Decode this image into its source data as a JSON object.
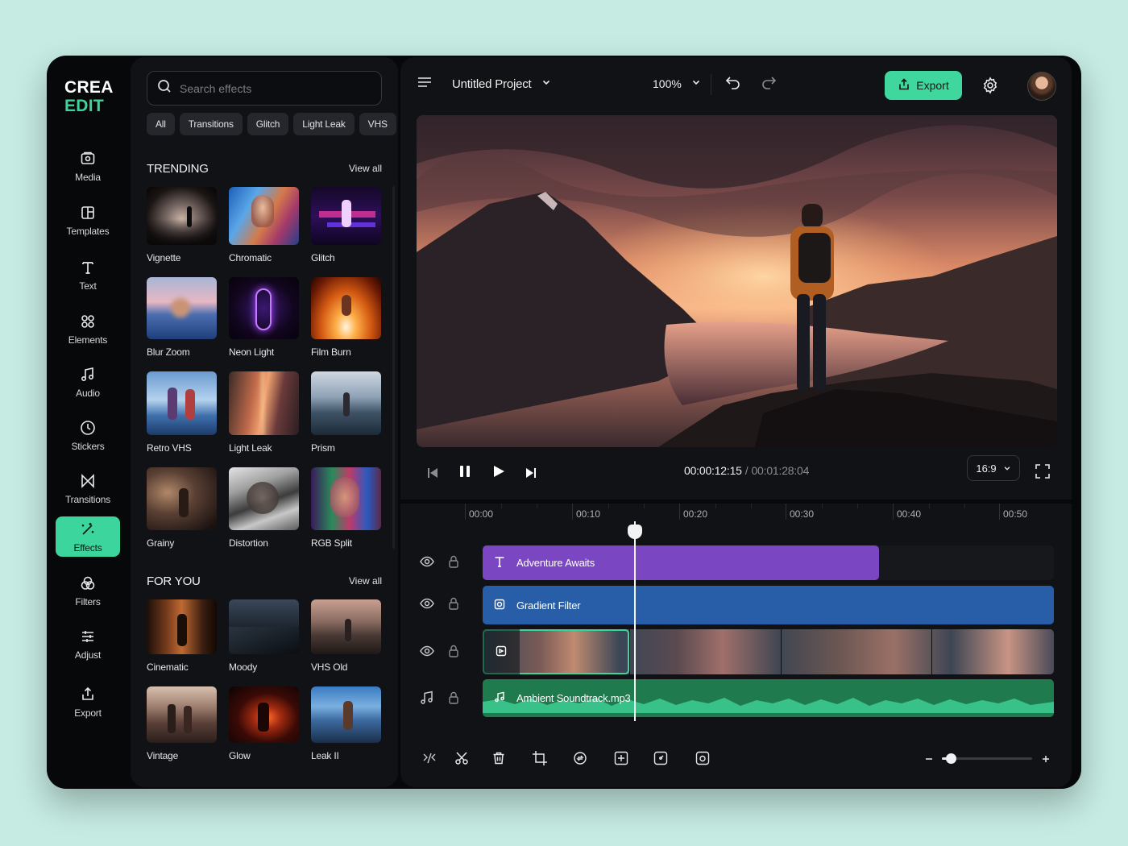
{
  "app": {
    "logo_line1": "CREA",
    "logo_line2": "EDIT",
    "accent": "#3dd59e"
  },
  "nav": {
    "items": [
      {
        "label": "Media",
        "icon": "media-icon"
      },
      {
        "label": "Templates",
        "icon": "templates-icon"
      },
      {
        "label": "Text",
        "icon": "text-icon"
      },
      {
        "label": "Elements",
        "icon": "elements-icon"
      },
      {
        "label": "Audio",
        "icon": "music-note-icon"
      },
      {
        "label": "Stickers",
        "icon": "sticker-icon"
      },
      {
        "label": "Transitions",
        "icon": "transition-icon"
      },
      {
        "label": "Effects",
        "icon": "magic-wand-icon",
        "active": true
      },
      {
        "label": "Filters",
        "icon": "filters-icon"
      },
      {
        "label": "Adjust",
        "icon": "sliders-icon"
      },
      {
        "label": "Export",
        "icon": "export-icon"
      }
    ]
  },
  "effects_panel": {
    "search_placeholder": "Search effects",
    "chips": [
      "All",
      "Transitions",
      "Glitch",
      "Light Leak",
      "VHS"
    ],
    "trending": {
      "title": "TRENDING",
      "view_all": "View all",
      "items": [
        "Vignette",
        "Chromatic",
        "Glitch",
        "Blur Zoom",
        "Neon Light",
        "Film Burn",
        "Retro VHS",
        "Light Leak",
        "Prism",
        "Grainy",
        "Distortion",
        "RGB Split"
      ]
    },
    "for_you": {
      "title": "FOR YOU",
      "view_all": "View all",
      "items": [
        "Cinematic",
        "Moody",
        "VHS Old",
        "Vintage",
        "Glow",
        "Leak II"
      ]
    }
  },
  "topbar": {
    "project_name": "Untitled Project",
    "zoom": "100%",
    "export_label": "Export"
  },
  "player": {
    "current_time": "00:00:12:15",
    "separator": "/",
    "total_time": "00:01:28:04",
    "aspect_ratio": "16:9"
  },
  "timeline": {
    "ruler": [
      "00:00",
      "00:10",
      "00:20",
      "00:30",
      "00:40",
      "00:50"
    ],
    "tracks": [
      {
        "clip_label": "Adventure Awaits",
        "type": "text",
        "color": "#7b46c1"
      },
      {
        "clip_label": "Gradient Filter",
        "type": "filter",
        "color": "#285ea8"
      },
      {
        "clip_label": "",
        "type": "video",
        "color": "#3dd59e"
      },
      {
        "clip_label": "Ambient Soundtrack.mp3",
        "type": "audio",
        "color": "#1f7a4e"
      }
    ],
    "playhead_seconds": 15.5,
    "zoom_level": 0.1
  }
}
